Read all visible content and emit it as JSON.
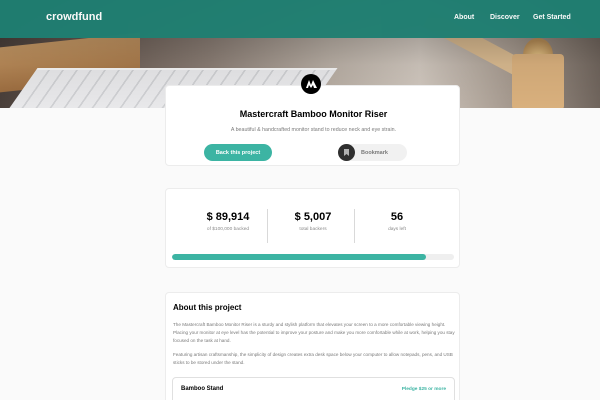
{
  "header": {
    "logo": "crowdfund",
    "nav": [
      "About",
      "Discover",
      "Get Started"
    ]
  },
  "project": {
    "title": "Mastercraft Bamboo Monitor Riser",
    "subtitle": "A beautiful & handcrafted monitor stand to reduce neck and eye strain.",
    "back_label": "Back this project",
    "bookmark_label": "Bookmark",
    "brand_icon": "mastercraft-logo-icon"
  },
  "stats": {
    "backed_value": "$ 89,914",
    "backed_label": "of $100,000 backed",
    "backers_value": "$ 5,007",
    "backers_label": "total backers",
    "days_value": "56",
    "days_label": "days left",
    "progress_fraction": 0.89914
  },
  "about": {
    "title": "About this project",
    "paragraph1": "The Mastercraft Bamboo Monitor Riser is a sturdy and stylish platform that elevates your screen to a more comfortable viewing height. Placing your monitor at eye level has the potential to improve your posture and make you more comfortable while at work, helping you stay focused on the task at hand.",
    "paragraph2": "Featuring artisan craftsmanship, the simplicity of design creates extra desk space below your computer to allow notepads, pens, and USB sticks to be stored under the stand."
  },
  "pledge": {
    "name": "Bamboo Stand",
    "min": "Pledge $25 or more"
  },
  "colors": {
    "accent": "#3cb4a3",
    "header": "#1f7f72"
  }
}
